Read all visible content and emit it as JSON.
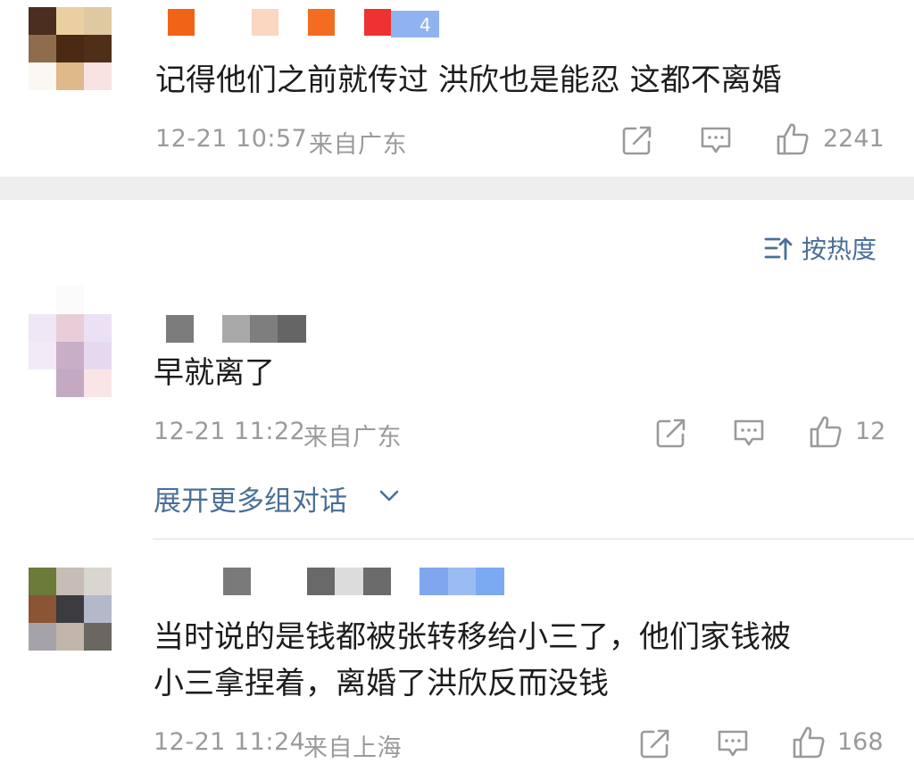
{
  "comments": [
    {
      "text": "记得他们之前就传过 洪欣也是能忍 这都不离婚",
      "time": "12-21 10:57",
      "location": "来自广东",
      "likes": "2241",
      "level_badge_fragment": "4"
    },
    {
      "text": "早就离了",
      "time": "12-21 11:22",
      "location": "来自广东",
      "likes": "12",
      "expand_label": "展开更多组对话"
    },
    {
      "text_line1": "当时说的是钱都被张转移给小三了，他们家钱被",
      "text_line2": "小三拿捏着，离婚了洪欣反而没钱",
      "time": "12-21 11:24",
      "location": "来自上海",
      "likes": "168"
    }
  ],
  "sort": {
    "label": "按热度"
  },
  "icons": {
    "share": "share-icon",
    "comment": "comment-icon",
    "like": "thumbs-up-icon",
    "sort": "sort-icon",
    "chevron": "chevron-down-icon"
  },
  "colors": {
    "link_blue": "#4a6f99",
    "meta_gray": "#9a9a9a",
    "text": "#1c1c1c",
    "separator": "#eeeeee"
  }
}
